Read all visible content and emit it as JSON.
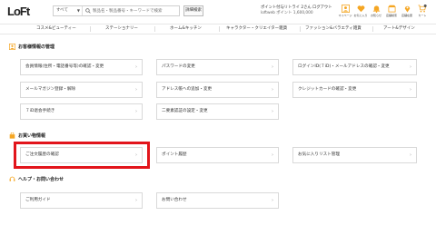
{
  "header": {
    "logo": "LoFt",
    "search_category": "すべて",
    "search_placeholder": "製品名・製品番号・キーワードで検索",
    "detail_search_label": "詳細検索",
    "points_line1": "ポイント付与リトライ 2さん ログアウト",
    "points_line2": "loftweb ポイント 1,600,000",
    "utilities": [
      {
        "label": "マイページ",
        "icon": "user-icon"
      },
      {
        "label": "お気に入り",
        "icon": "heart-icon"
      },
      {
        "label": "お知らせ",
        "icon": "bell-icon"
      },
      {
        "label": "店舗検索",
        "icon": "store-icon"
      },
      {
        "label": "店舗在庫",
        "icon": "location-icon"
      },
      {
        "label": "カート",
        "icon": "cart-icon",
        "badge": "0"
      }
    ]
  },
  "nav": {
    "items": [
      "コスメ&ビューティー",
      "ステーショナリー",
      "ホーム&キッチン",
      "キャラクター・クリエイター雑貨",
      "ファッション&バラエティ雑貨",
      "アート&デザイン"
    ]
  },
  "sections": {
    "member": {
      "title": "お客様情報の管理",
      "cards": [
        "会員情報(住所・電話番号等)の確認・変更",
        "パスワードの変更",
        "ログインID(７iD)・メールアドレスの確認・変更",
        "メールマガジン登録・解除",
        "アドレス帳への追加・変更",
        "クレジットカードの確認・変更",
        "７iD退会手続き",
        "二要素認証の設定・変更"
      ]
    },
    "shopping": {
      "title": "お買い物情報",
      "cards": [
        "ご注文履歴の確認",
        "ポイント履歴",
        "お気に入りリスト管理"
      ]
    },
    "help": {
      "title": "ヘルプ・お問い合わせ",
      "cards": [
        "ご利用ガイド",
        "お問い合わせ"
      ]
    }
  },
  "chevron": "›",
  "colors": {
    "accent": "#f5a623",
    "highlight": "#e2151b"
  }
}
